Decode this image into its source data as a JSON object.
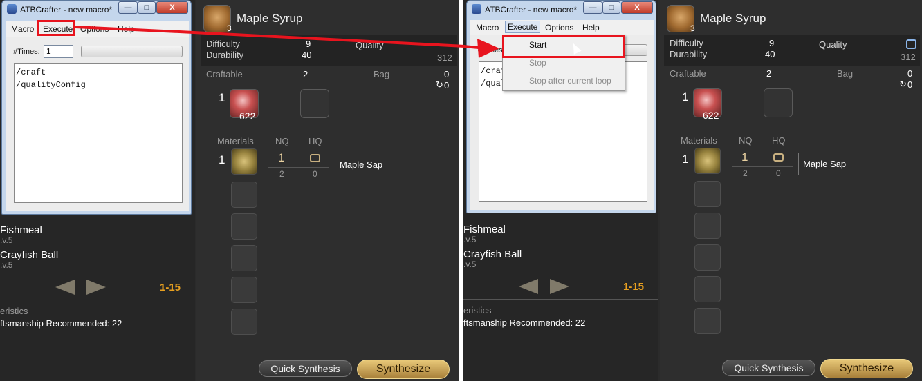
{
  "colors": {
    "annotation_red": "#e8141e",
    "game_gold": "#e8a020"
  },
  "game": {
    "item_name": "Maple Syrup",
    "item_icon_count": "3",
    "difficulty_label": "Difficulty",
    "difficulty_value": "9",
    "durability_label": "Durability",
    "durability_value": "40",
    "quality_label": "Quality",
    "quality_value": "312",
    "craftable_label": "Craftable",
    "craftable_value": "2",
    "bag_label": "Bag",
    "bag_value": "0",
    "bag_hq_value": "0",
    "crystal_need": "1",
    "crystal_have": "622",
    "materials_label": "Materials",
    "nq_label": "NQ",
    "hq_label": "HQ",
    "mat_need": "1",
    "mat_nq_sel": "1",
    "mat_nq_have": "2",
    "mat_hq_have": "0",
    "mat_name": "Maple Sap",
    "list_item1_name": "Fishmeal",
    "list_item1_lv": ".v.5",
    "list_item2_name": "Crayfish Ball",
    "list_item2_lv": ".v.5",
    "page_range": "1-15",
    "characteristics": "eristics",
    "recommended": "ftsmanship Recommended: 22",
    "quick_synthesis": "Quick Synthesis",
    "synthesize": "Synthesize"
  },
  "window": {
    "title": "ATBCrafter - new macro*",
    "minimize": "—",
    "maximize": "□",
    "close": "X",
    "menu": [
      "Macro",
      "Execute",
      "Options",
      "Help"
    ],
    "times_label": "#Times:",
    "times_value": "1",
    "script": [
      "/craft",
      "/qualityConfig"
    ],
    "execute_menu": [
      "Start",
      "Stop",
      "Stop after current loop"
    ]
  }
}
